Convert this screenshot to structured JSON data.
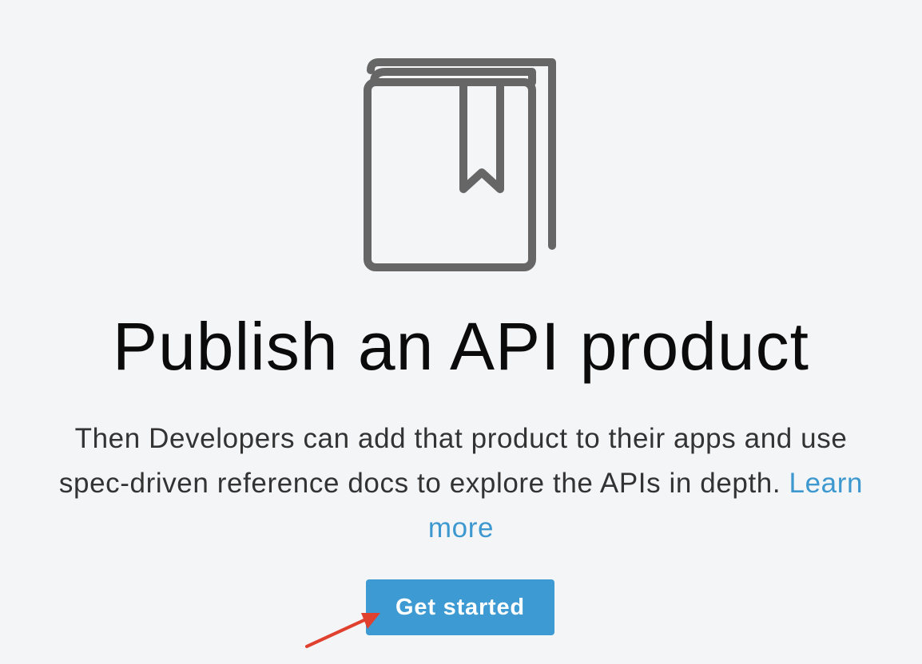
{
  "icons": {
    "hero": "book-bookmark-icon",
    "annotation": "red-arrow-icon"
  },
  "hero": {
    "title": "Publish an API product",
    "description": "Then Developers can add that product to their apps and use spec-driven reference docs to explore the APIs in depth.",
    "learn_more_label": "Learn more"
  },
  "actions": {
    "get_started_label": "Get started"
  },
  "colors": {
    "background": "#f4f5f7",
    "icon_stroke": "#666666",
    "link": "#3d98d0",
    "primary_button": "#3e9ad3",
    "annotation_arrow": "#e0412f"
  }
}
